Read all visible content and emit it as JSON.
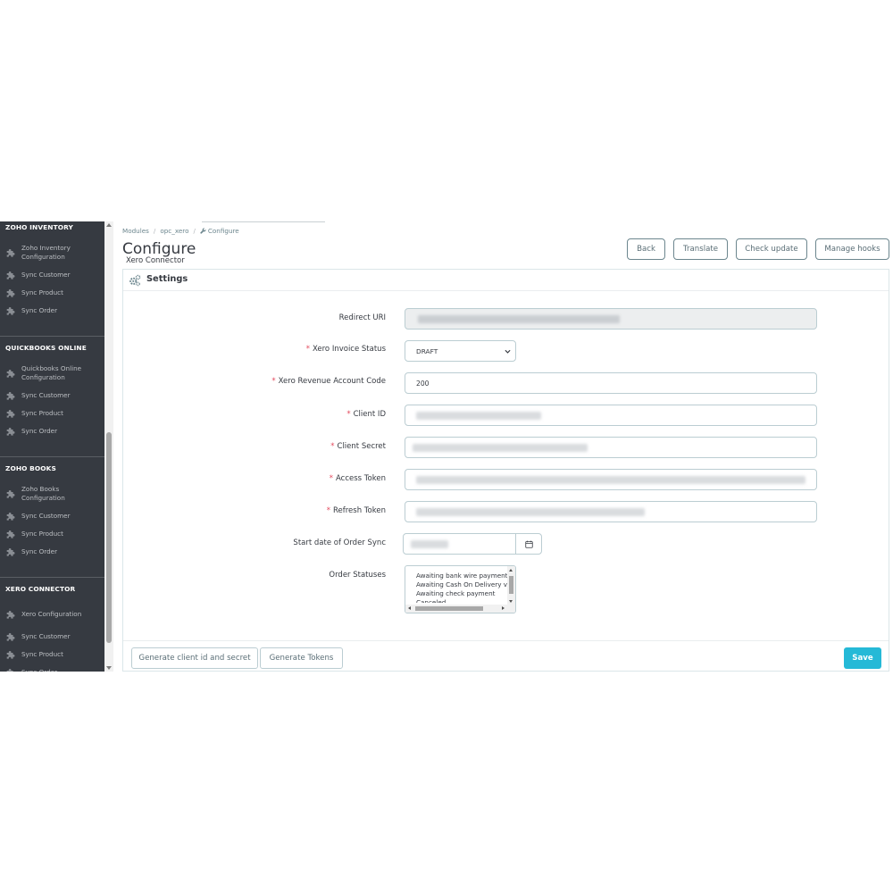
{
  "colors": {
    "sidebar_bg": "#363a41",
    "accent": "#25b9d7",
    "required": "#e3495d"
  },
  "sidebar": {
    "sections": [
      {
        "title": "ZOHO INVENTORY",
        "items": [
          {
            "label_lines": [
              "Zoho Inventory",
              "Configuration"
            ],
            "icon": "puzzle-icon"
          },
          {
            "label_lines": [
              "Sync Customer"
            ],
            "icon": "puzzle-icon"
          },
          {
            "label_lines": [
              "Sync Product"
            ],
            "icon": "puzzle-icon"
          },
          {
            "label_lines": [
              "Sync Order"
            ],
            "icon": "puzzle-icon"
          }
        ]
      },
      {
        "title": "QUICKBOOKS ONLINE",
        "items": [
          {
            "label_lines": [
              "Quickbooks Online",
              "Configuration"
            ],
            "icon": "puzzle-icon"
          },
          {
            "label_lines": [
              "Sync Customer"
            ],
            "icon": "puzzle-icon"
          },
          {
            "label_lines": [
              "Sync Product"
            ],
            "icon": "puzzle-icon"
          },
          {
            "label_lines": [
              "Sync Order"
            ],
            "icon": "puzzle-icon"
          }
        ]
      },
      {
        "title": "ZOHO BOOKS",
        "items": [
          {
            "label_lines": [
              "Zoho Books",
              "Configuration"
            ],
            "icon": "puzzle-icon"
          },
          {
            "label_lines": [
              "Sync Customer"
            ],
            "icon": "puzzle-icon"
          },
          {
            "label_lines": [
              "Sync Product"
            ],
            "icon": "puzzle-icon"
          },
          {
            "label_lines": [
              "Sync Order"
            ],
            "icon": "puzzle-icon"
          }
        ]
      },
      {
        "title": "XERO CONNECTOR",
        "items": [
          {
            "label_lines": [
              "Xero Configuration"
            ],
            "icon": "puzzle-icon"
          },
          {
            "label_lines": [
              "Sync Customer"
            ],
            "icon": "puzzle-icon"
          },
          {
            "label_lines": [
              "Sync Product"
            ],
            "icon": "puzzle-icon"
          },
          {
            "label_lines": [
              "Sync Order"
            ],
            "icon": "puzzle-icon"
          }
        ]
      }
    ]
  },
  "breadcrumb": {
    "items": [
      "Modules",
      "opc_xero",
      "Configure"
    ],
    "separator": "/"
  },
  "header": {
    "title": "Configure",
    "subtitle": "Xero Connector",
    "buttons": {
      "back": "Back",
      "translate": "Translate",
      "check_update": "Check update",
      "manage_hooks": "Manage hooks"
    }
  },
  "panel": {
    "title": "Settings",
    "fields": {
      "redirect_uri": {
        "label": "Redirect URI",
        "required": false
      },
      "invoice_status": {
        "label": "Xero Invoice Status",
        "required": true,
        "value": "DRAFT"
      },
      "revenue_code": {
        "label": "Xero Revenue Account Code",
        "required": true,
        "value": "200"
      },
      "client_id": {
        "label": "Client ID",
        "required": true
      },
      "client_secret": {
        "label": "Client Secret",
        "required": true
      },
      "access_token": {
        "label": "Access Token",
        "required": true
      },
      "refresh_token": {
        "label": "Refresh Token",
        "required": true
      },
      "start_date": {
        "label": "Start date of Order Sync",
        "required": false
      },
      "order_statuses": {
        "label": "Order Statuses",
        "required": false,
        "options": [
          "Awaiting bank wire payment",
          "Awaiting Cash On Delivery vali",
          "Awaiting check payment",
          "Canceled"
        ]
      }
    },
    "required_mark": "*"
  },
  "footer": {
    "generate_client": "Generate client id and secret",
    "generate_tokens": "Generate Tokens",
    "save": "Save"
  }
}
